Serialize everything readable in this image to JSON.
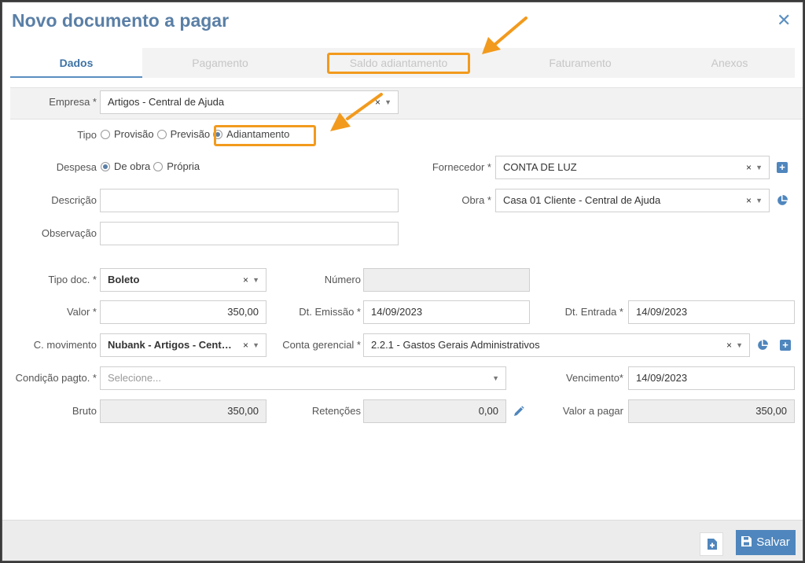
{
  "modal": {
    "title": "Novo documento a pagar"
  },
  "tabs": [
    {
      "label": "Dados",
      "active": true
    },
    {
      "label": "Pagamento",
      "active": false
    },
    {
      "label": "Saldo adiantamento",
      "active": false
    },
    {
      "label": "Faturamento",
      "active": false
    },
    {
      "label": "Anexos",
      "active": false
    }
  ],
  "form": {
    "empresa": {
      "label": "Empresa *",
      "value": "Artigos - Central de Ajuda"
    },
    "tipo": {
      "label": "Tipo",
      "options": [
        "Provisão",
        "Previsão",
        "Adiantamento"
      ],
      "selected": "Adiantamento"
    },
    "despesa": {
      "label": "Despesa",
      "options": [
        "De obra",
        "Própria"
      ],
      "selected": "De obra"
    },
    "fornecedor": {
      "label": "Fornecedor *",
      "value": "CONTA DE LUZ"
    },
    "descricao": {
      "label": "Descrição",
      "value": ""
    },
    "obra": {
      "label": "Obra *",
      "value": "Casa 01 Cliente - Central de Ajuda"
    },
    "observacao": {
      "label": "Observação",
      "value": ""
    },
    "tipo_doc": {
      "label": "Tipo doc. *",
      "value": "Boleto"
    },
    "numero": {
      "label": "Número",
      "value": ""
    },
    "valor": {
      "label": "Valor *",
      "value": "350,00"
    },
    "dt_emissao": {
      "label": "Dt. Emissão *",
      "value": "14/09/2023"
    },
    "dt_entrada": {
      "label": "Dt. Entrada *",
      "value": "14/09/2023"
    },
    "c_movimento": {
      "label": "C. movimento",
      "value": "Nubank - Artigos - Centra..."
    },
    "conta_gerencial": {
      "label": "Conta gerencial *",
      "value": "2.2.1 - Gastos Gerais Administrativos"
    },
    "condicao_pagto": {
      "label": "Condição pagto. *",
      "placeholder": "Selecione..."
    },
    "vencimento": {
      "label": "Vencimento*",
      "value": "14/09/2023"
    },
    "bruto": {
      "label": "Bruto",
      "value": "350,00"
    },
    "retencoes": {
      "label": "Retenções",
      "value": "0,00"
    },
    "valor_a_pagar": {
      "label": "Valor a pagar",
      "value": "350,00"
    }
  },
  "footer": {
    "save_label": "Salvar"
  },
  "glyphs": {
    "close": "✕",
    "clear": "×",
    "caret": "▼"
  },
  "colors": {
    "accent": "#4f86bd",
    "title": "#5a7fa6",
    "annotation": "#f29a1d"
  }
}
